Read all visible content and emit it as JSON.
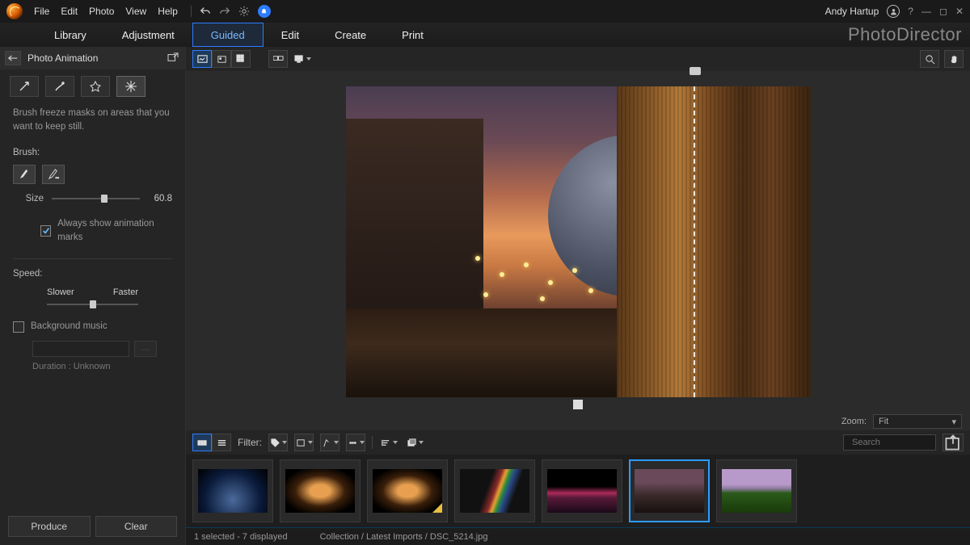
{
  "menu": {
    "items": [
      "File",
      "Edit",
      "Photo",
      "View",
      "Help"
    ]
  },
  "user": {
    "name": "Andy Hartup"
  },
  "tabs": [
    "Library",
    "Adjustment",
    "Guided",
    "Edit",
    "Create",
    "Print"
  ],
  "activeTab": "Guided",
  "brand": "PhotoDirector",
  "left": {
    "title": "Photo Animation",
    "hint": "Brush freeze masks on areas that you want to keep still.",
    "brush_label": "Brush:",
    "size_label": "Size",
    "size_value": "60.8",
    "always_show": "Always show animation marks",
    "speed_label": "Speed:",
    "slower": "Slower",
    "faster": "Faster",
    "bgm": "Background music",
    "duration": "Duration : Unknown",
    "produce": "Produce",
    "clear": "Clear"
  },
  "zoom": {
    "label": "Zoom:",
    "value": "Fit"
  },
  "fsbar": {
    "filter": "Filter:",
    "search_ph": "Search"
  },
  "status": {
    "sel": "1 selected - 7 displayed",
    "path": "Collection / Latest Imports / DSC_5214.jpg"
  }
}
